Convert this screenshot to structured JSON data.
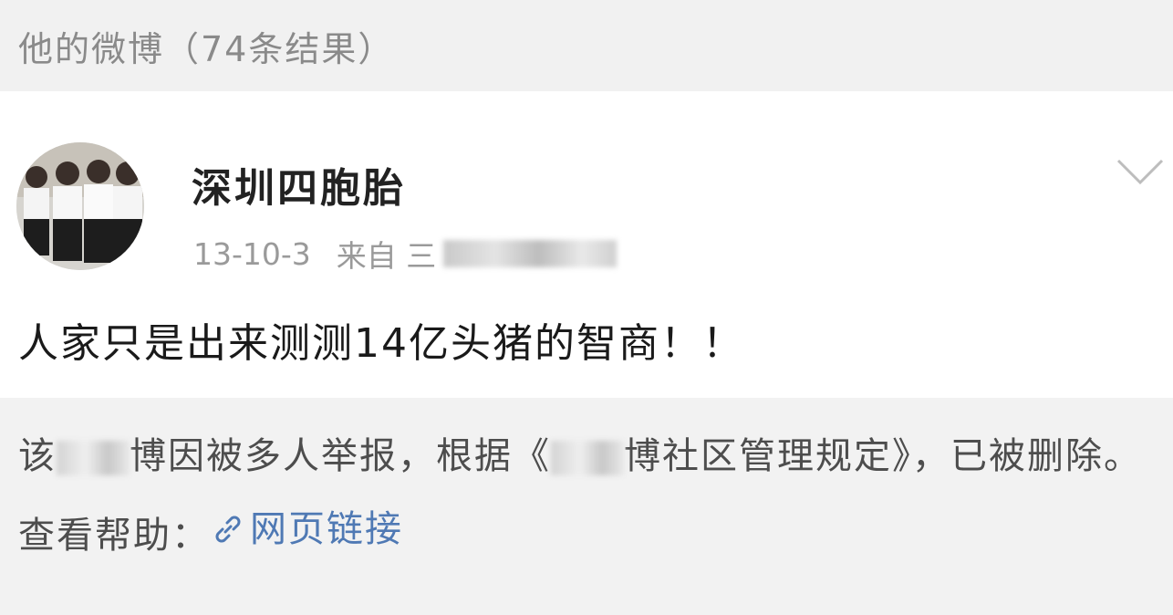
{
  "header": {
    "title": "他的微博（74条结果）"
  },
  "post": {
    "author": "深圳四胞胎",
    "date": "13-10-3",
    "source_prefix": "来自 三",
    "text": "人家只是出来测测14亿头猪的智商！！"
  },
  "notice": {
    "part1": "该",
    "part2": "博因被多人举报，根据《",
    "part3": "博社区管理规定》，已被删除。查看帮助：",
    "link_label": "网页链接"
  },
  "icons": {
    "chevron": "chevron-down-icon",
    "link": "link-icon"
  },
  "colors": {
    "link": "#4f79b4",
    "background": "#f2f2f2",
    "card": "#ffffff"
  }
}
